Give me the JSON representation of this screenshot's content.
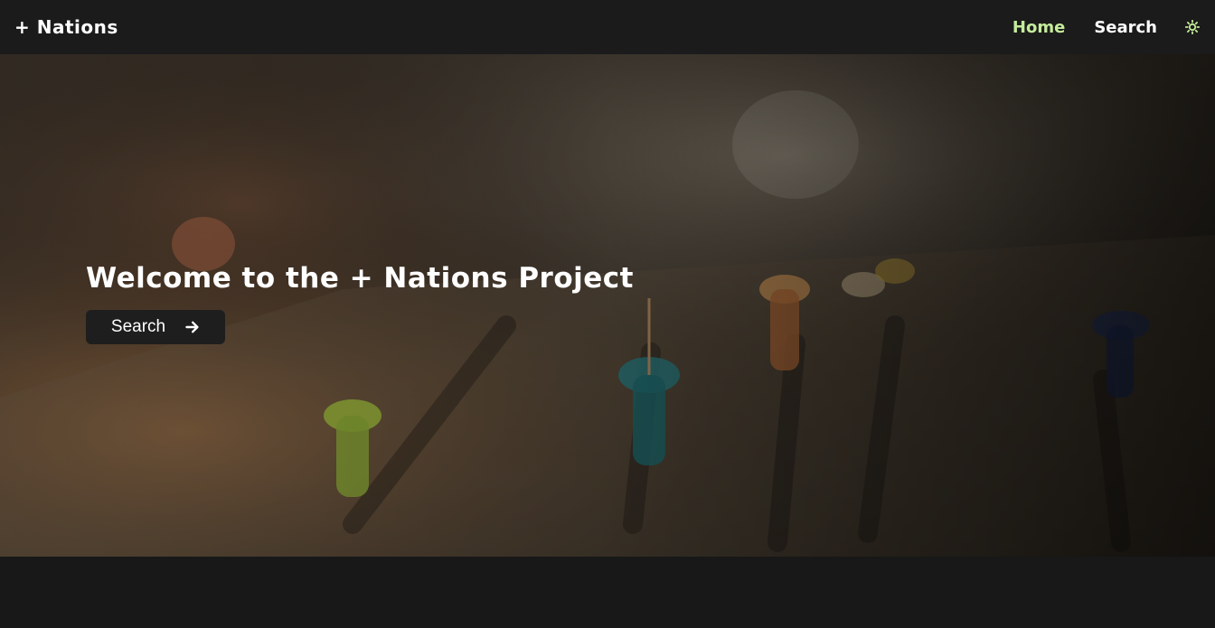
{
  "navbar": {
    "brand": "+ Nations",
    "links": [
      {
        "label": "Home",
        "active": true
      },
      {
        "label": "Search",
        "active": false
      }
    ],
    "theme_icon": "sun-icon",
    "accent_color": "#c4ec9b"
  },
  "hero": {
    "title": "Welcome to the + Nations Project",
    "button_label": "Search",
    "button_icon": "arrow-right-icon",
    "background": "map-with-pushpins-photo"
  }
}
